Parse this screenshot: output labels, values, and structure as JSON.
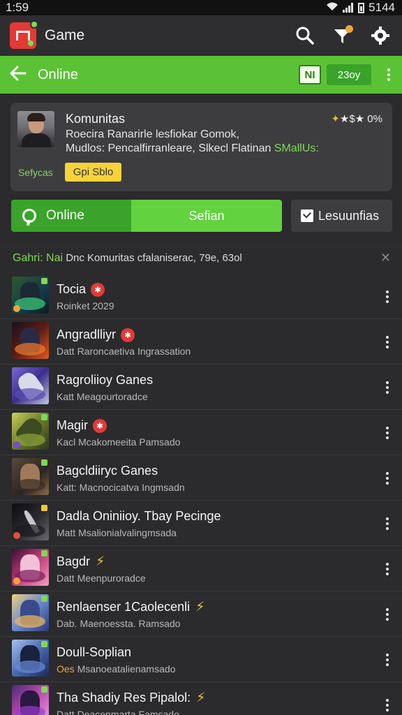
{
  "status_bar": {
    "time": "1:59",
    "battery_text": "5144"
  },
  "app_bar": {
    "title": "Game",
    "icons": [
      "search-icon",
      "filter-icon",
      "gear-icon"
    ]
  },
  "green_header": {
    "title": "Online",
    "chip_label": "NI",
    "button_label": "23oy"
  },
  "community_card": {
    "title": "Komunitas",
    "rating": "★$★ 0%",
    "line1": "Roecira Ranarirle lesfiokar Gomok,",
    "line2_prefix": "Mudlos: Pencalfirranleare, Slkecl Flatinan ",
    "line2_highlight": "SMallUs:",
    "green_label": "Sefycas",
    "yellow_button": "Gpi Sblo"
  },
  "tabs": {
    "tab1": "Online",
    "tab2": "Sefian",
    "side_button": "Lesuunfias"
  },
  "list": {
    "header_green": "Gahri: Nai",
    "header_text": " Dnc Komuritas cfalaniserac, 79e, 63ol",
    "items": [
      {
        "title": "Tocia",
        "sub": "Roinket 2029",
        "badge": "red"
      },
      {
        "title": "Angradlliyr",
        "sub": "Datt Raroncaetiva Ingrassation",
        "badge": "red"
      },
      {
        "title": "Ragroliioy Ganes",
        "sub": "Katt Meagourtoradce",
        "badge": ""
      },
      {
        "title": "Magir",
        "sub": "Kacl Mcakomeeita Pamsado",
        "badge": "red"
      },
      {
        "title": "Bagcldiiryc Ganes",
        "sub": "Katt: Macnocicatva Ingmsadn",
        "badge": ""
      },
      {
        "title": "Dadla Oniniioy. Tbay Pecinge",
        "sub": "Matt Msalionialvalingmsada",
        "badge": ""
      },
      {
        "title": "Bagdr",
        "sub": "Datt Meenpuroradce",
        "badge": "spark"
      },
      {
        "title": "Renlaenser 1Caolecenli",
        "sub": "Dab. Maenoessta. Ramsado",
        "badge": "spark"
      },
      {
        "title": "Doull-Soplian",
        "sub_prefix": "Oes",
        "sub": " Msanoeatalienamsado",
        "badge": ""
      },
      {
        "title": "Tha Shadiy Res Pipalol:",
        "sub": "Datt Deacenmarta Famsado",
        "badge": "spark"
      }
    ]
  },
  "colors": {
    "green": "#5bc236",
    "dark_green": "#3aa32a",
    "accent_yellow": "#f7d33a",
    "red": "#e53935",
    "background": "#2a2a2c"
  }
}
